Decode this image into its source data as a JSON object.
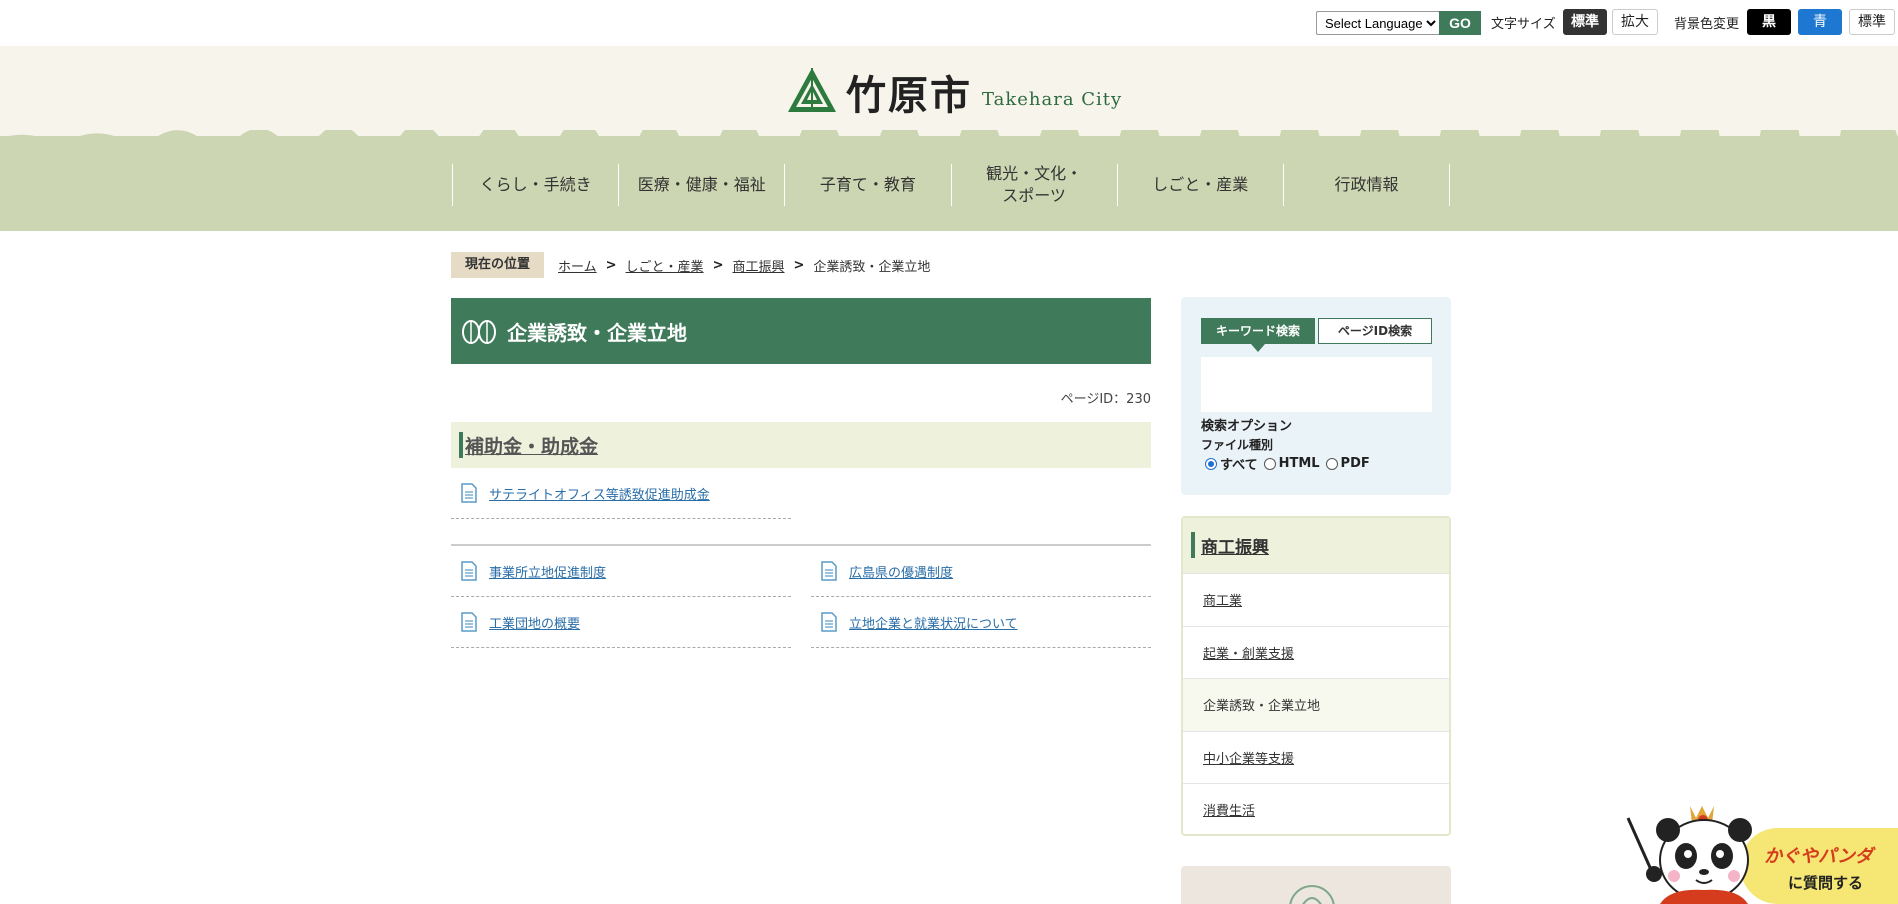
{
  "utility": {
    "language_select": "Select Language",
    "go_label": "GO",
    "font_size_label": "文字サイズ",
    "font_size_standard": "標準",
    "font_size_large": "拡大",
    "bg_color_label": "背景色変更",
    "bg_black": "黒",
    "bg_blue": "青",
    "bg_standard": "標準"
  },
  "header": {
    "logo_ja": "竹原市",
    "logo_en": "Takehara City"
  },
  "gnav": {
    "items": [
      {
        "label": "くらし・手続き"
      },
      {
        "label": "医療・健康・福祉"
      },
      {
        "label": "子育て・教育"
      },
      {
        "label": "観光・文化・\nスポーツ"
      },
      {
        "label": "しごと・産業"
      },
      {
        "label": "行政情報"
      }
    ]
  },
  "breadcrumb": {
    "label": "現在の位置",
    "items": [
      "ホーム",
      "しごと・産業",
      "商工振興"
    ],
    "separator": ">",
    "current": "企業誘致・企業立地"
  },
  "main": {
    "title": "企業誘致・企業立地",
    "page_id": "ページID：230",
    "section_title": "補助金・助成金",
    "section_links": [
      "サテライトオフィス等誘致促進助成金"
    ],
    "links": [
      "事業所立地促進制度",
      "広島県の優遇制度",
      "工業団地の概要",
      "立地企業と就業状況について"
    ]
  },
  "search": {
    "tab_keyword": "キーワード検索",
    "tab_page_id": "ページID検索",
    "options_label": "検索オプション",
    "file_type_label": "ファイル種別",
    "file_types": [
      "すべて",
      "HTML",
      "PDF"
    ]
  },
  "subnav": {
    "title": "商工振興",
    "items": [
      {
        "label": "商工業",
        "current": false
      },
      {
        "label": "起業・創業支援",
        "current": false
      },
      {
        "label": "企業誘致・企業立地",
        "current": true
      },
      {
        "label": "中小企業等支援",
        "current": false
      },
      {
        "label": "消費生活",
        "current": false
      }
    ]
  },
  "chatbot": {
    "line1": "かぐやパンダ",
    "line2": "に質問する"
  },
  "colors": {
    "brand_green": "#3f7a5a",
    "nav_bg": "#cdd6b2",
    "header_bg": "#f7f4ec",
    "link_blue": "#2a6ea8"
  }
}
